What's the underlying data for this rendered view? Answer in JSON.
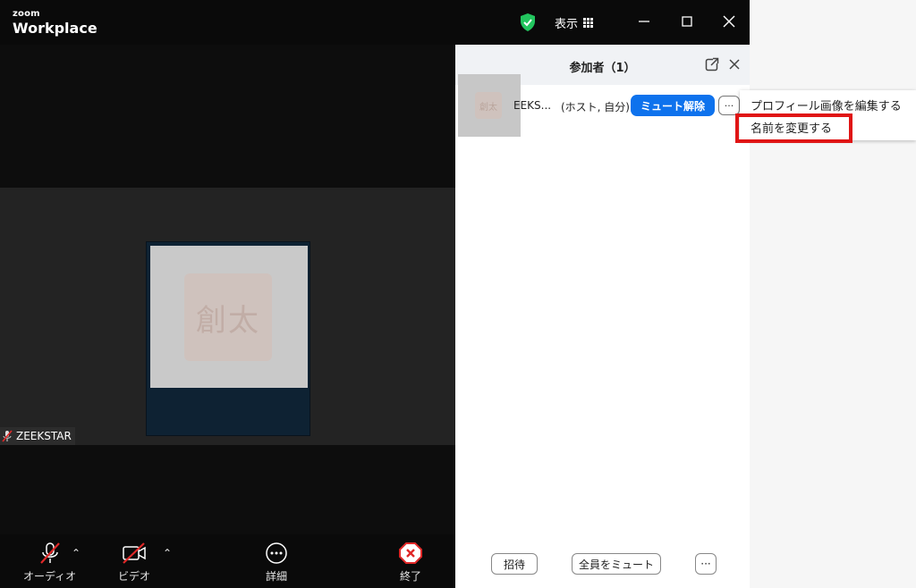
{
  "titlebar": {
    "brand_small": "zoom",
    "brand_big": "Workplace",
    "view_label": "表示"
  },
  "video": {
    "avatar_text": "創太",
    "name_tag": "ZEEKSTAR"
  },
  "toolbar": {
    "audio_label": "オーディオ",
    "video_label": "ビデオ",
    "more_label": "詳細",
    "end_label": "終了"
  },
  "participants": {
    "title": "参加者（1）",
    "items": [
      {
        "avatar_text": "創太",
        "name": "EEKS...",
        "role": "(ホスト, 自分)",
        "unmute_label": "ミュート解除",
        "more_label": "···"
      }
    ],
    "invite_label": "招待",
    "mute_all_label": "全員をミュート",
    "footer_more_label": "···"
  },
  "context_menu": {
    "items": [
      "プロフィール画像を編集する",
      "名前を変更する"
    ]
  },
  "colors": {
    "accent": "#0e72ed",
    "highlight": "#e01515",
    "shield": "#22c55e",
    "end": "#e02828"
  }
}
